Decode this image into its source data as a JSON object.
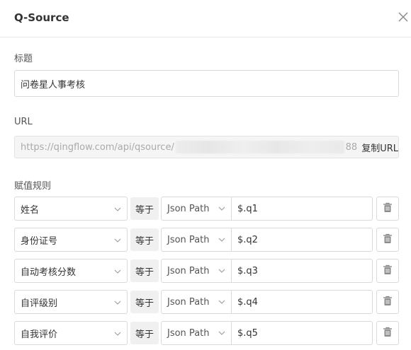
{
  "dialog": {
    "title": "Q-Source"
  },
  "form": {
    "title_label": "标题",
    "title_value": "问卷星人事考核",
    "url_label": "URL",
    "url_prefix": "https://qingflow.com/api/qsource/",
    "url_suffix": "88",
    "copy_label": "复制URL",
    "rules_label": "赋值规则"
  },
  "rules": [
    {
      "field": "姓名",
      "operator": "等于",
      "type": "Json Path",
      "value": "$.q1"
    },
    {
      "field": "身份证号",
      "operator": "等于",
      "type": "Json Path",
      "value": "$.q2"
    },
    {
      "field": "自动考核分数",
      "operator": "等于",
      "type": "Json Path",
      "value": "$.q3"
    },
    {
      "field": "自评级别",
      "operator": "等于",
      "type": "Json Path",
      "value": "$.q4"
    },
    {
      "field": "自我评价",
      "operator": "等于",
      "type": "Json Path",
      "value": "$.q5"
    }
  ],
  "icons": {
    "close": "close-icon",
    "chevron": "chevron-down-icon",
    "delete": "trash-icon"
  },
  "colors": {
    "border": "#d9d9d9",
    "icon": "#8a8a8a"
  }
}
